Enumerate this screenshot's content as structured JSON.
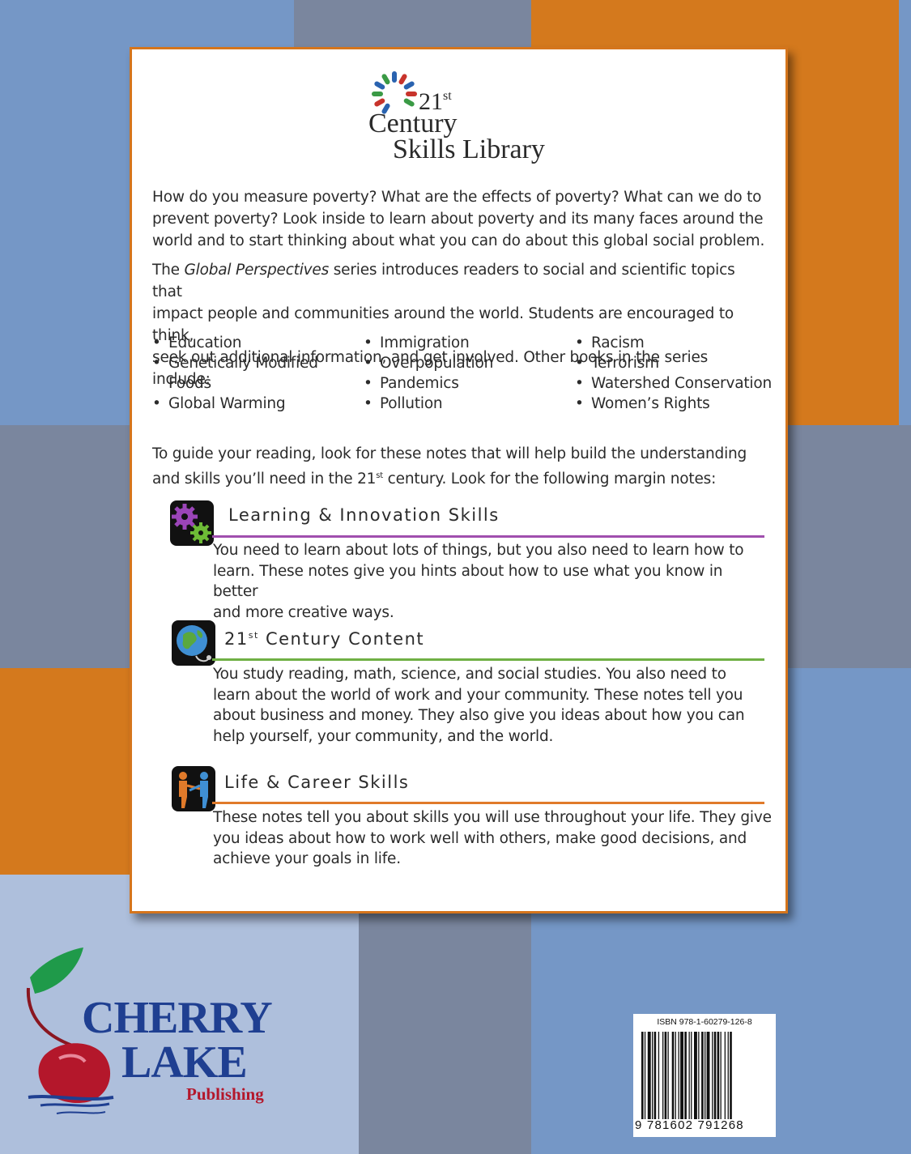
{
  "series_logo": {
    "num": "21",
    "sup": "st",
    "line2": "Century",
    "line3": "Skills Library"
  },
  "intro": {
    "line1": "How do you measure poverty? What are the effects of poverty? What can we do to",
    "line2": "prevent poverty? Look inside to learn about poverty and its many faces around the",
    "line3": "world and to start thinking about what you can do about this global social problem."
  },
  "series_desc": {
    "prefix": "The ",
    "series_name": "Global Perspectives",
    "line1_rest": " series introduces readers to social and scientific topics that",
    "line2": "impact people and communities around the world. Students are encouraged to think,",
    "line3": "seek out additional information, and get involved. Other books in the series include:"
  },
  "books": {
    "col1": [
      "Education",
      "Genetically Modified",
      "Foods",
      "Global Warming"
    ],
    "col2": [
      "Immigration",
      "Overpopulation",
      "Pandemics",
      "Pollution"
    ],
    "col3": [
      "Racism",
      "Terrorism",
      "Watershed Conservation",
      "Women’s Rights"
    ]
  },
  "guide": {
    "line1": "To guide your reading, look for these notes that will help build the understanding",
    "line2a": "and skills you’ll need in the 21",
    "line2sup": "st",
    "line2b": " century. Look for the following margin notes:"
  },
  "notes": [
    {
      "title": "Learning & Innovation Skills",
      "color": "#a04fae",
      "icon": "gears-icon",
      "lines": [
        "You need to learn about lots of things, but you also need to learn how to",
        "learn. These notes give you hints about how to use what you know in better",
        "and more creative ways."
      ]
    },
    {
      "title_num": "21",
      "title_sup": "st",
      "title_rest": " Century Content",
      "color": "#6fb044",
      "icon": "globe-icon",
      "lines": [
        "You study reading, math, science, and social studies. You also need to",
        "learn about the world of work and your community. These notes tell you",
        "about business and money. They also give you ideas about how you can",
        "help yourself, your community, and the world."
      ]
    },
    {
      "title": "Life & Career Skills",
      "color": "#e07a2a",
      "icon": "handshake-icon",
      "lines": [
        "These notes tell you about skills you will use throughout your life. They give",
        "you ideas about how to work well with others, make good decisions, and",
        "achieve your goals in life."
      ]
    }
  ],
  "publisher": {
    "line1": "CHERRY",
    "line2": "LAKE",
    "line3": "Publishing"
  },
  "isbn": {
    "label": "ISBN 978-1-60279-126-8",
    "digits": "9 781602 791268"
  },
  "colors": {
    "panel_border": "#d5751c",
    "orange": "#d4791d",
    "slate": "#7a869e",
    "blue": "#7597c6",
    "pale_blue": "#aebfdc"
  }
}
